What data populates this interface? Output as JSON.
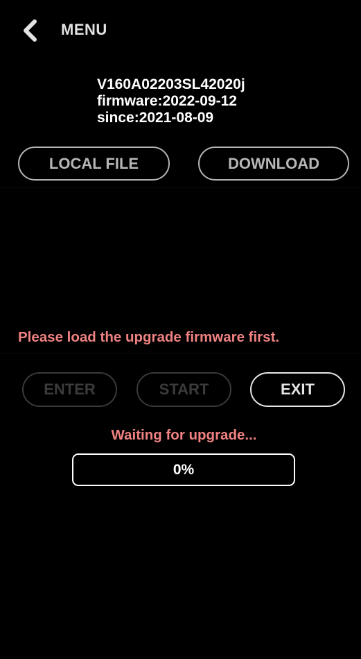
{
  "header": {
    "back_icon": "chevron-left-icon",
    "title": "MENU"
  },
  "device": {
    "serial": "V160A02203SL42020j",
    "firmware": "firmware:2022-09-12",
    "since": "since:2021-08-09"
  },
  "source_buttons": {
    "local_file": "LOCAL FILE",
    "download": "DOWNLOAD"
  },
  "notice": "Please load the upgrade firmware first.",
  "action_buttons": {
    "enter": "ENTER",
    "start": "START",
    "exit": "EXIT"
  },
  "status": "Waiting for upgrade...",
  "progress": {
    "value": 0,
    "label": "0%"
  },
  "colors": {
    "background": "#000000",
    "warning_text": "#f08282",
    "text": "#ffffff",
    "disabled": "#3a3a3a"
  }
}
